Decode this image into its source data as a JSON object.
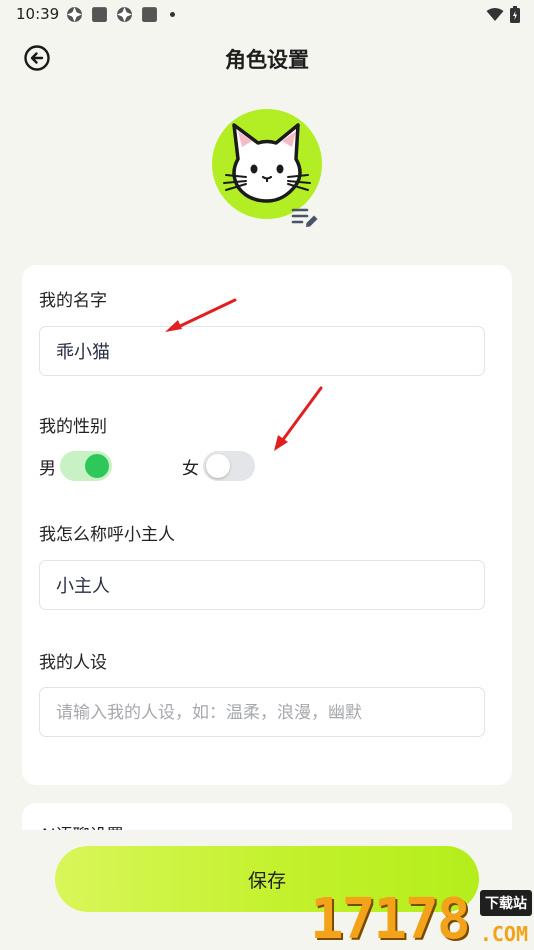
{
  "status_bar": {
    "time": "10:39",
    "icons_left": [
      "app-notification-icon",
      "square-icon",
      "app-notification-icon",
      "square-icon",
      "dot-icon"
    ],
    "icons_right": [
      "wifi-icon",
      "battery-icon"
    ]
  },
  "header": {
    "title": "角色设置",
    "back_icon": "back-arrow-icon"
  },
  "avatar": {
    "image": "white-cat-avatar",
    "background_color": "#b3ee24",
    "edit_icon": "edit-list-icon"
  },
  "form": {
    "name": {
      "label": "我的名字",
      "value": "乖小猫"
    },
    "gender": {
      "label": "我的性别",
      "options": [
        {
          "label": "男",
          "selected": true
        },
        {
          "label": "女",
          "selected": false
        }
      ]
    },
    "address_user": {
      "label": "我怎么称呼小主人",
      "value": "小主人"
    },
    "persona": {
      "label": "我的人设",
      "value": "",
      "placeholder": "请输入我的人设，如：温柔，浪漫，幽默"
    }
  },
  "next_section": {
    "title": "AI语聊设置"
  },
  "actions": {
    "save_label": "保存"
  },
  "watermark": {
    "digits": "17178",
    "badge": "下载站",
    "domain": ".COM"
  },
  "colors": {
    "accent": "#b3ee24",
    "switch_on": "#2ec85a",
    "annotation_arrow": "#e02020"
  }
}
